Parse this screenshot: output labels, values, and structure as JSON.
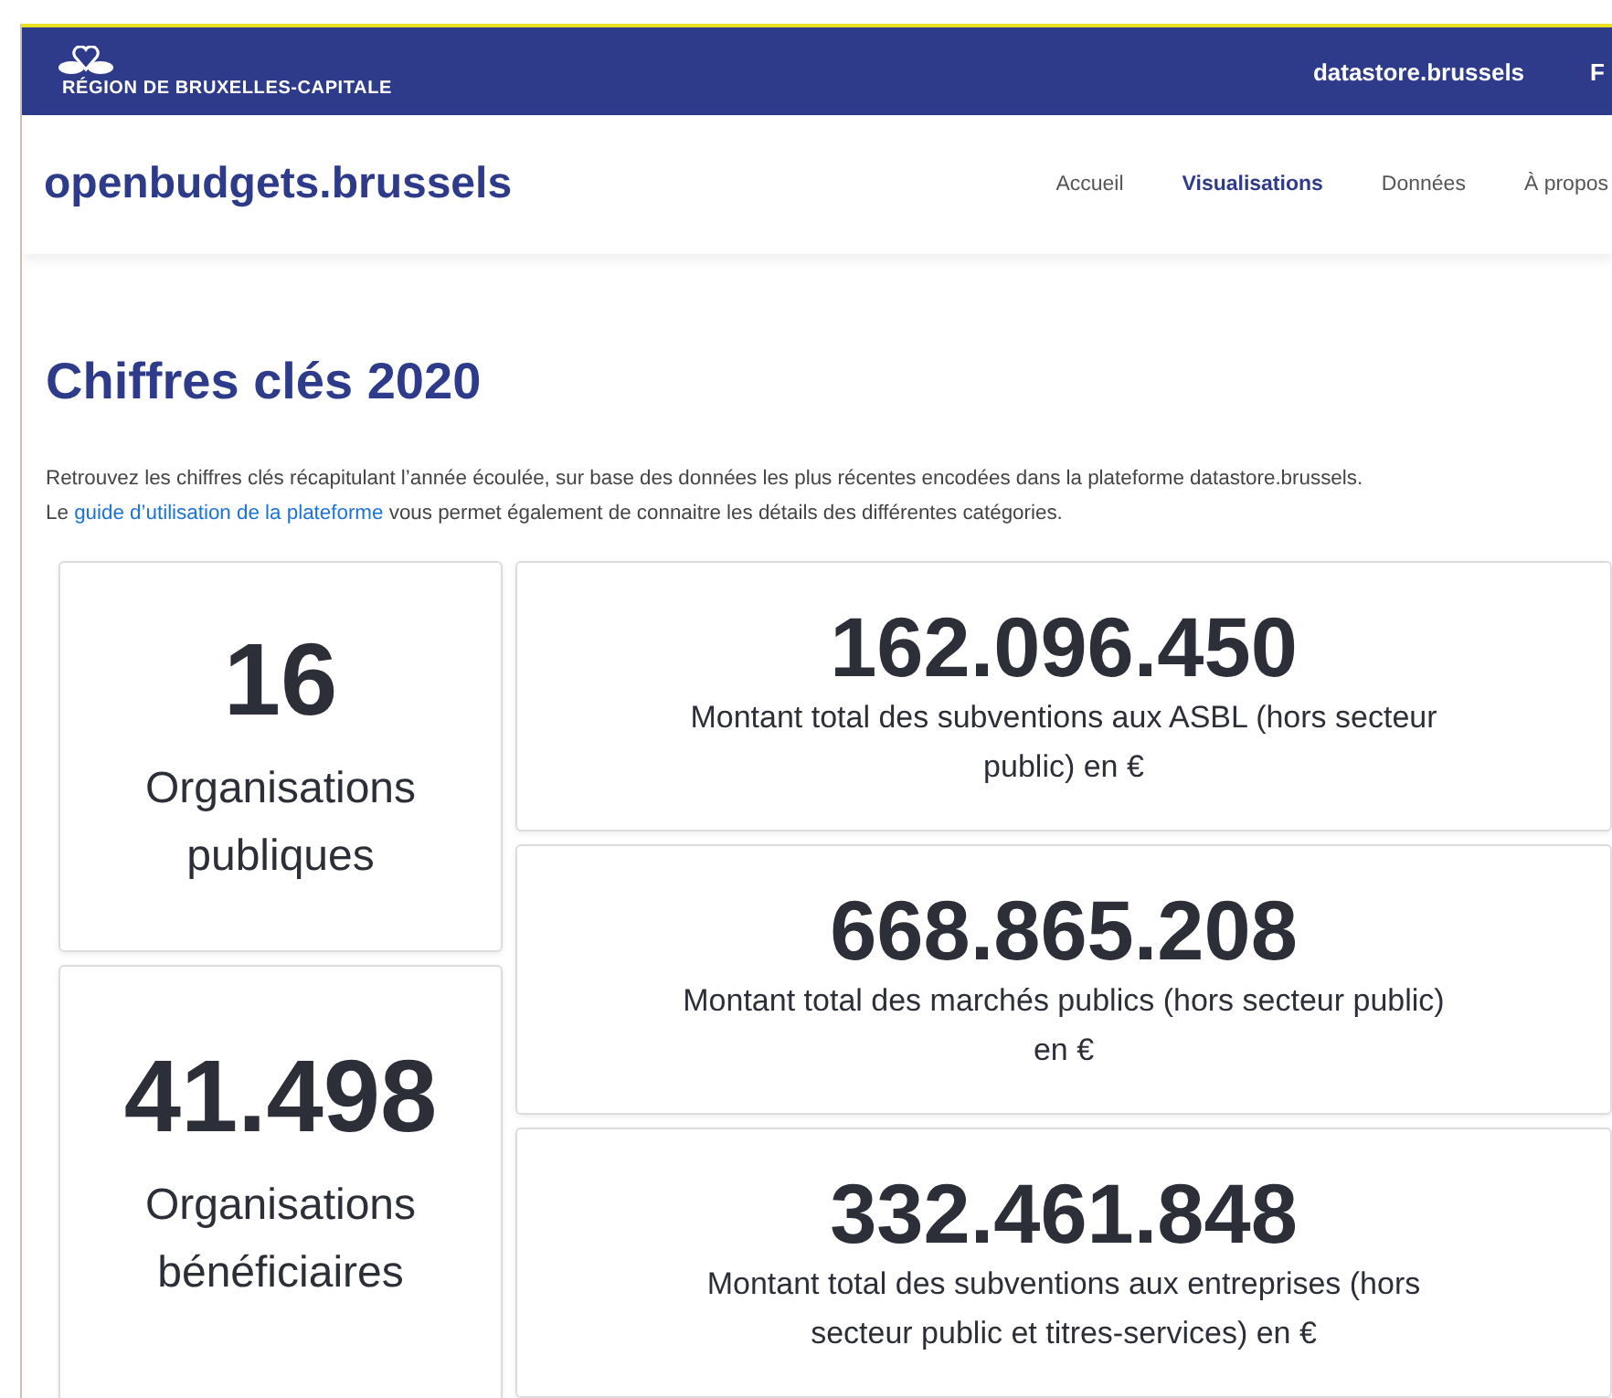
{
  "top_bar": {
    "region": "RÉGION DE BRUXELLES-CAPITALE",
    "links": [
      "datastore.brussels",
      "F"
    ]
  },
  "header": {
    "brand": "openbudgets.brussels",
    "nav": [
      {
        "label": "Accueil",
        "selected": false
      },
      {
        "label": "Visualisations",
        "selected": true
      },
      {
        "label": "Données",
        "selected": false
      },
      {
        "label": "À propos",
        "selected": false
      }
    ]
  },
  "title": "Chiffres clés 2020",
  "intro": {
    "line_1": "Retrouvez les chiffres clés récapitulant l’année écoulée, sur base des données les plus récentes encodées dans la plateforme datastore.brussels.",
    "prefix": "Le",
    "link": "guide d’utilisation de la plateforme",
    "suffix": "vous permet également de connaitre les détails des différentes catégories."
  },
  "left_cards": [
    {
      "value": "16",
      "label": "Organisations publiques"
    },
    {
      "value": "41.498",
      "label": "Organisations bénéficiaires"
    }
  ],
  "right_cards": [
    {
      "value": "162.096.450",
      "label": "Montant total des subventions aux ASBL (hors secteur public) en €"
    },
    {
      "value": "668.865.208",
      "label": "Montant total des marchés publics (hors secteur public) en €"
    },
    {
      "value": "332.461.848",
      "label": "Montant total des subventions aux entreprises (hors secteur public et titres-services) en €"
    }
  ]
}
